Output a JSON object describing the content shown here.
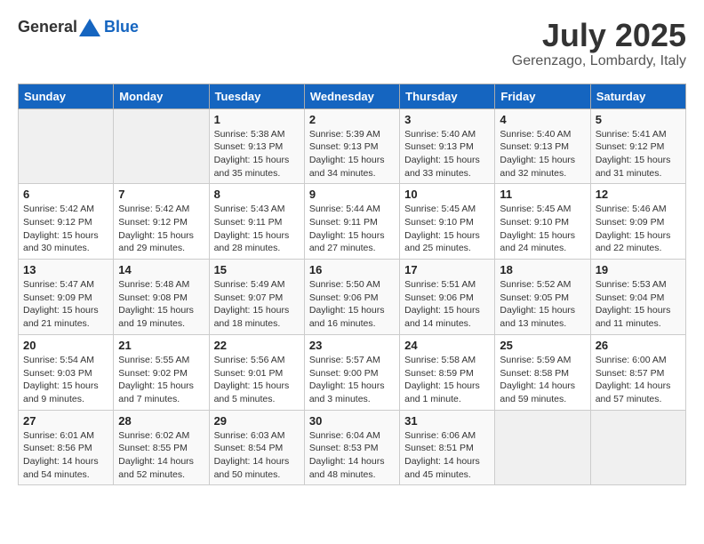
{
  "header": {
    "logo_general": "General",
    "logo_blue": "Blue",
    "month_title": "July 2025",
    "location": "Gerenzago, Lombardy, Italy"
  },
  "weekdays": [
    "Sunday",
    "Monday",
    "Tuesday",
    "Wednesday",
    "Thursday",
    "Friday",
    "Saturday"
  ],
  "weeks": [
    [
      {
        "day": "",
        "info": ""
      },
      {
        "day": "",
        "info": ""
      },
      {
        "day": "1",
        "info": "Sunrise: 5:38 AM\nSunset: 9:13 PM\nDaylight: 15 hours\nand 35 minutes."
      },
      {
        "day": "2",
        "info": "Sunrise: 5:39 AM\nSunset: 9:13 PM\nDaylight: 15 hours\nand 34 minutes."
      },
      {
        "day": "3",
        "info": "Sunrise: 5:40 AM\nSunset: 9:13 PM\nDaylight: 15 hours\nand 33 minutes."
      },
      {
        "day": "4",
        "info": "Sunrise: 5:40 AM\nSunset: 9:13 PM\nDaylight: 15 hours\nand 32 minutes."
      },
      {
        "day": "5",
        "info": "Sunrise: 5:41 AM\nSunset: 9:12 PM\nDaylight: 15 hours\nand 31 minutes."
      }
    ],
    [
      {
        "day": "6",
        "info": "Sunrise: 5:42 AM\nSunset: 9:12 PM\nDaylight: 15 hours\nand 30 minutes."
      },
      {
        "day": "7",
        "info": "Sunrise: 5:42 AM\nSunset: 9:12 PM\nDaylight: 15 hours\nand 29 minutes."
      },
      {
        "day": "8",
        "info": "Sunrise: 5:43 AM\nSunset: 9:11 PM\nDaylight: 15 hours\nand 28 minutes."
      },
      {
        "day": "9",
        "info": "Sunrise: 5:44 AM\nSunset: 9:11 PM\nDaylight: 15 hours\nand 27 minutes."
      },
      {
        "day": "10",
        "info": "Sunrise: 5:45 AM\nSunset: 9:10 PM\nDaylight: 15 hours\nand 25 minutes."
      },
      {
        "day": "11",
        "info": "Sunrise: 5:45 AM\nSunset: 9:10 PM\nDaylight: 15 hours\nand 24 minutes."
      },
      {
        "day": "12",
        "info": "Sunrise: 5:46 AM\nSunset: 9:09 PM\nDaylight: 15 hours\nand 22 minutes."
      }
    ],
    [
      {
        "day": "13",
        "info": "Sunrise: 5:47 AM\nSunset: 9:09 PM\nDaylight: 15 hours\nand 21 minutes."
      },
      {
        "day": "14",
        "info": "Sunrise: 5:48 AM\nSunset: 9:08 PM\nDaylight: 15 hours\nand 19 minutes."
      },
      {
        "day": "15",
        "info": "Sunrise: 5:49 AM\nSunset: 9:07 PM\nDaylight: 15 hours\nand 18 minutes."
      },
      {
        "day": "16",
        "info": "Sunrise: 5:50 AM\nSunset: 9:06 PM\nDaylight: 15 hours\nand 16 minutes."
      },
      {
        "day": "17",
        "info": "Sunrise: 5:51 AM\nSunset: 9:06 PM\nDaylight: 15 hours\nand 14 minutes."
      },
      {
        "day": "18",
        "info": "Sunrise: 5:52 AM\nSunset: 9:05 PM\nDaylight: 15 hours\nand 13 minutes."
      },
      {
        "day": "19",
        "info": "Sunrise: 5:53 AM\nSunset: 9:04 PM\nDaylight: 15 hours\nand 11 minutes."
      }
    ],
    [
      {
        "day": "20",
        "info": "Sunrise: 5:54 AM\nSunset: 9:03 PM\nDaylight: 15 hours\nand 9 minutes."
      },
      {
        "day": "21",
        "info": "Sunrise: 5:55 AM\nSunset: 9:02 PM\nDaylight: 15 hours\nand 7 minutes."
      },
      {
        "day": "22",
        "info": "Sunrise: 5:56 AM\nSunset: 9:01 PM\nDaylight: 15 hours\nand 5 minutes."
      },
      {
        "day": "23",
        "info": "Sunrise: 5:57 AM\nSunset: 9:00 PM\nDaylight: 15 hours\nand 3 minutes."
      },
      {
        "day": "24",
        "info": "Sunrise: 5:58 AM\nSunset: 8:59 PM\nDaylight: 15 hours\nand 1 minute."
      },
      {
        "day": "25",
        "info": "Sunrise: 5:59 AM\nSunset: 8:58 PM\nDaylight: 14 hours\nand 59 minutes."
      },
      {
        "day": "26",
        "info": "Sunrise: 6:00 AM\nSunset: 8:57 PM\nDaylight: 14 hours\nand 57 minutes."
      }
    ],
    [
      {
        "day": "27",
        "info": "Sunrise: 6:01 AM\nSunset: 8:56 PM\nDaylight: 14 hours\nand 54 minutes."
      },
      {
        "day": "28",
        "info": "Sunrise: 6:02 AM\nSunset: 8:55 PM\nDaylight: 14 hours\nand 52 minutes."
      },
      {
        "day": "29",
        "info": "Sunrise: 6:03 AM\nSunset: 8:54 PM\nDaylight: 14 hours\nand 50 minutes."
      },
      {
        "day": "30",
        "info": "Sunrise: 6:04 AM\nSunset: 8:53 PM\nDaylight: 14 hours\nand 48 minutes."
      },
      {
        "day": "31",
        "info": "Sunrise: 6:06 AM\nSunset: 8:51 PM\nDaylight: 14 hours\nand 45 minutes."
      },
      {
        "day": "",
        "info": ""
      },
      {
        "day": "",
        "info": ""
      }
    ]
  ]
}
